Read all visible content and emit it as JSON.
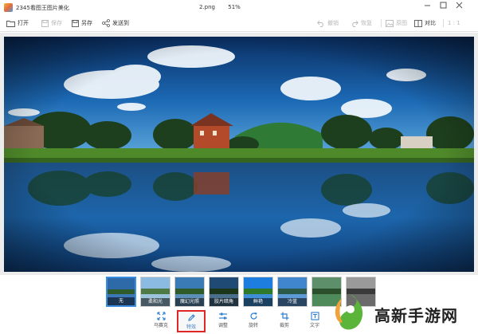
{
  "window": {
    "app_title": "2345看图王图片美化",
    "file_name": "2.png",
    "zoom": "51%"
  },
  "toolbar": {
    "open": "打开",
    "save": "保存",
    "save_as": "另存",
    "send": "发送到",
    "undo": "撤销",
    "redo": "恢复",
    "original": "原图",
    "compare": "对比",
    "ratio": "1 : 1"
  },
  "thumbnails": [
    {
      "label": "无",
      "selected": true,
      "tint": "#6fa2c9"
    },
    {
      "label": "柔和光",
      "selected": false,
      "tint": "#9cc4dc"
    },
    {
      "label": "魔幻光照",
      "selected": false,
      "tint": "#5b8fb8"
    },
    {
      "label": "胶片暗角",
      "selected": false,
      "tint": "#4a6f8c"
    },
    {
      "label": "鲜艳",
      "selected": false,
      "tint": "#3f8fd6"
    },
    {
      "label": "冷蓝",
      "selected": false,
      "tint": "#5c9ad8"
    },
    {
      "label": "",
      "selected": false,
      "tint": "#4f8a5a"
    },
    {
      "label": "",
      "selected": false,
      "tint": "#6b6b6b"
    }
  ],
  "bottom_tools": [
    {
      "label": "马赛克",
      "icon": "mosaic-icon"
    },
    {
      "label": "特效",
      "icon": "pencil-icon",
      "active": true
    },
    {
      "label": "调整",
      "icon": "sliders-icon"
    },
    {
      "label": "旋转",
      "icon": "rotate-icon"
    },
    {
      "label": "裁剪",
      "icon": "crop-icon"
    },
    {
      "label": "文字",
      "icon": "text-icon"
    }
  ],
  "watermark": {
    "text": "高新手游网"
  },
  "colors": {
    "accent_blue": "#3b8de0",
    "active_border": "#e1262b",
    "watermark_green": "#5bb53a",
    "watermark_orange": "#f1a33b"
  }
}
